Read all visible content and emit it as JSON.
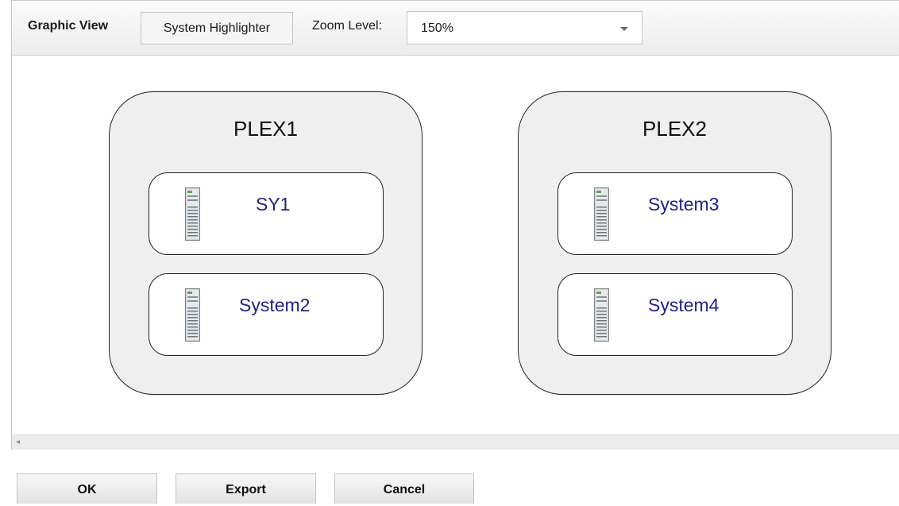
{
  "toolbar": {
    "title": "Graphic View",
    "highlighter_label": "System Highlighter",
    "zoom_label": "Zoom Level:",
    "zoom_value": "150%"
  },
  "plexes": [
    {
      "name": "PLEX1",
      "systems": [
        "SY1",
        "System2"
      ]
    },
    {
      "name": "PLEX2",
      "systems": [
        "System3",
        "System4"
      ]
    }
  ],
  "icons": {
    "system": "server-tower-icon",
    "scroll": "scroll-left-arrow-icon",
    "dropdown": "chevron-down-icon"
  },
  "colors": {
    "system_label": "#1f1f8f",
    "plex_fill": "#efefef"
  },
  "footer": {
    "ok": "OK",
    "export": "Export",
    "cancel": "Cancel"
  }
}
